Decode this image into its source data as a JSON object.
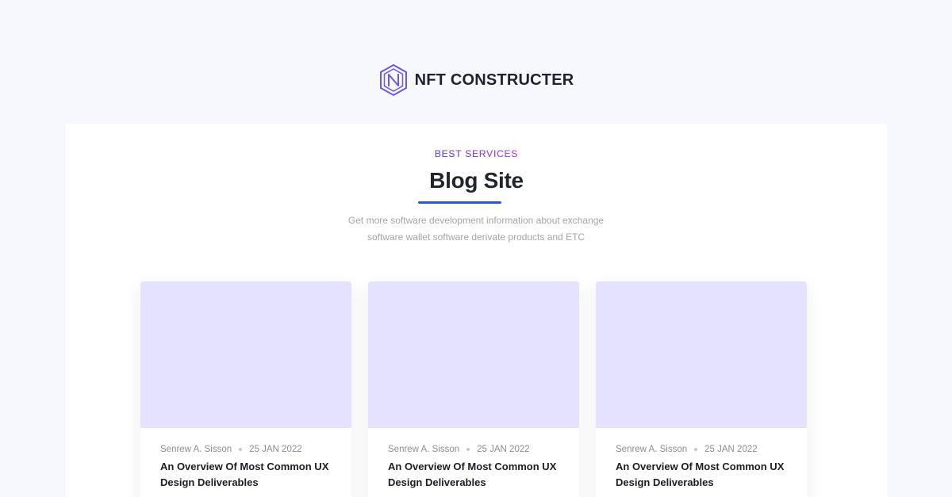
{
  "brand": {
    "name": "NFT CONSTRUCTER",
    "logo_icon": "hexagon-n-logo-icon",
    "accent_color": "#6a5ae0"
  },
  "section": {
    "eyebrow": "BEST SERVICES",
    "title": "Blog Site",
    "subtitle_line1": "Get more software development information about exchange",
    "subtitle_line2": "software wallet software derivate products and ETC",
    "underline_color": "#2b54d6"
  },
  "cards": [
    {
      "author": "Senrew A. Sisson",
      "date": "25 JAN 2022",
      "title": "An Overview Of Most Common UX Design Deliverables",
      "image_color": "#e4e2fc"
    },
    {
      "author": "Senrew A. Sisson",
      "date": "25 JAN 2022",
      "title": "An Overview Of Most Common UX Design Deliverables",
      "image_color": "#e4e2fc"
    },
    {
      "author": "Senrew A. Sisson",
      "date": "25 JAN 2022",
      "title": "An Overview Of Most Common UX Design Deliverables",
      "image_color": "#e4e2fc"
    }
  ]
}
